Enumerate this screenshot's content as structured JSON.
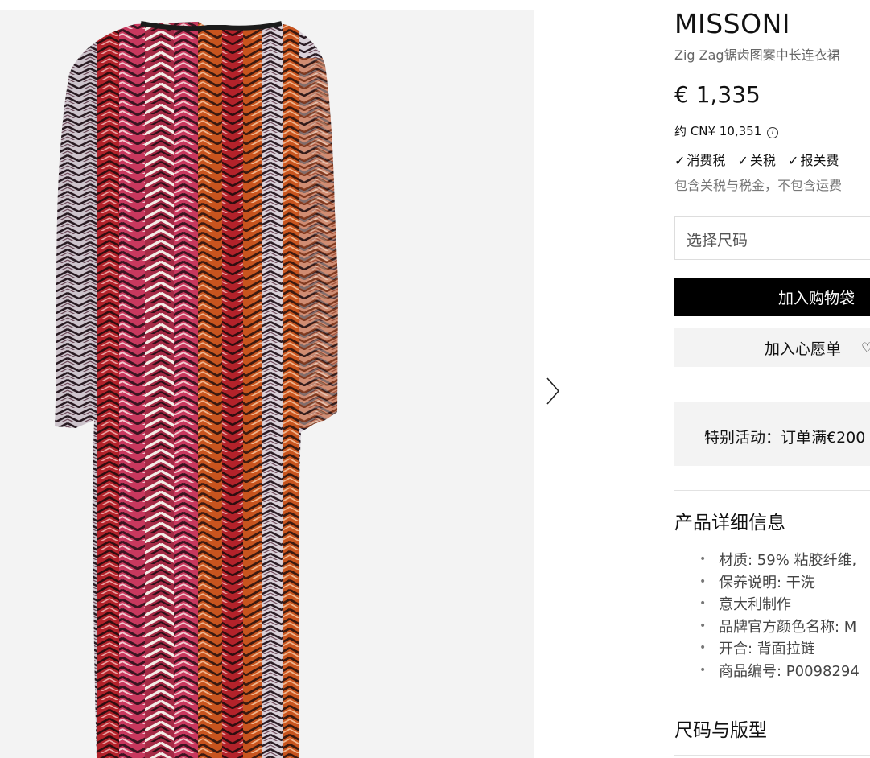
{
  "product": {
    "brand": "MISSONI",
    "name": "Zig Zag锯齿图案中长连衣裙",
    "price": "€ 1,335",
    "cny_price": "约 CN¥ 10,351",
    "info_icon_glyph": "i",
    "tax_checks": [
      "消费税",
      "关税",
      "报关费"
    ],
    "tax_note": "包含关税与税金，不包含运费"
  },
  "size_select": {
    "placeholder": "选择尺码"
  },
  "buttons": {
    "add_to_bag": "加入购物袋",
    "add_to_wishlist": "加入心愿单"
  },
  "promo": {
    "text": "特别活动：订单满€200"
  },
  "details_section": {
    "title": "产品详细信息",
    "items": [
      "材质: 59% 粘胶纤维,",
      "保养说明: 干洗",
      "意大利制作",
      "品牌官方颜色名称: M",
      "开合: 背面拉链",
      "商品编号: P0098294"
    ]
  },
  "size_fit_section": {
    "title": "尺码与版型"
  },
  "icons": {
    "next": "chevron-right-icon",
    "info": "info-circle-icon",
    "check": "check-icon",
    "wishlist": "heart-outline-icon"
  },
  "colors": {
    "primary_button": "#000000",
    "secondary_button": "#f3f3f3",
    "image_background": "#f3f3f3"
  }
}
